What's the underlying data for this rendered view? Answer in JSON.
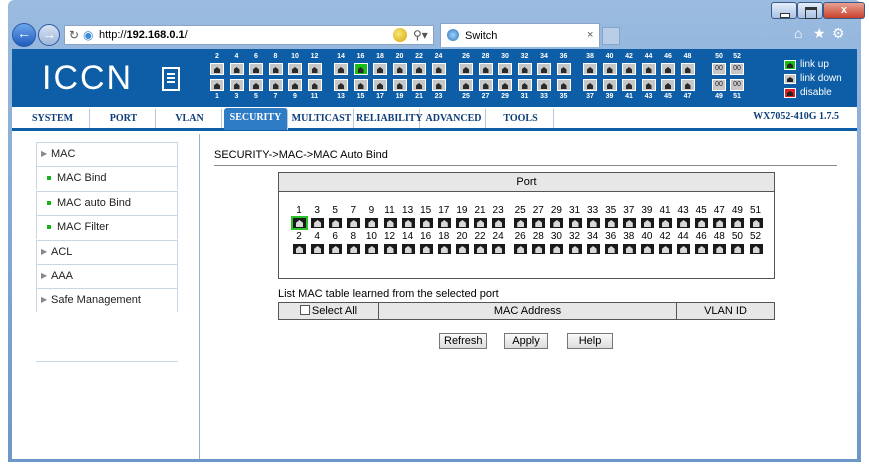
{
  "browser": {
    "url_prefix": "http://",
    "url_host": "192.168.0.1",
    "url_suffix": "/",
    "tab_title": "Switch",
    "tab_close": "×",
    "close_glyph": "x"
  },
  "banner": {
    "logo_text": "ICCN",
    "top_row_numbers": [
      "2",
      "4",
      "6",
      "8",
      "10",
      "12",
      "14",
      "16",
      "18",
      "20",
      "22",
      "24",
      "26",
      "28",
      "30",
      "32",
      "34",
      "36",
      "38",
      "40",
      "42",
      "44",
      "46",
      "48"
    ],
    "bottom_row_numbers": [
      "1",
      "3",
      "5",
      "7",
      "9",
      "11",
      "13",
      "15",
      "17",
      "19",
      "21",
      "23",
      "25",
      "27",
      "29",
      "31",
      "33",
      "35",
      "37",
      "39",
      "41",
      "43",
      "45",
      "47"
    ],
    "sfp_top_numbers": [
      "50",
      "52"
    ],
    "sfp_bottom_numbers": [
      "49",
      "51"
    ],
    "sfp_label": "00",
    "link_up_port": "16",
    "legend": {
      "link_up": "link up",
      "link_down": "link down",
      "disable": "disable"
    },
    "colors": {
      "link_up": "#19c019",
      "link_down": "#c7c7c7",
      "disable": "#e02020"
    }
  },
  "menu": {
    "items": [
      "SYSTEM",
      "PORT",
      "VLAN",
      "SECURITY",
      "MULTICAST",
      "RELIABILITY",
      "ADVANCED",
      "TOOLS"
    ],
    "active": "SECURITY",
    "version": "WX7052-410G 1.7.5"
  },
  "sidebar": {
    "items": [
      {
        "label": "MAC",
        "type": "top"
      },
      {
        "label": "MAC Bind",
        "type": "sub"
      },
      {
        "label": "MAC auto Bind",
        "type": "sub"
      },
      {
        "label": "MAC Filter",
        "type": "sub"
      },
      {
        "label": "ACL",
        "type": "top"
      },
      {
        "label": "AAA",
        "type": "top"
      },
      {
        "label": "Safe Management",
        "type": "top"
      }
    ]
  },
  "main": {
    "breadcrumb": "SECURITY->MAC->MAC Auto Bind",
    "port_header": "Port",
    "odd_ports": [
      "1",
      "3",
      "5",
      "7",
      "9",
      "11",
      "13",
      "15",
      "17",
      "19",
      "21",
      "23",
      "25",
      "27",
      "29",
      "31",
      "33",
      "35",
      "37",
      "39",
      "41",
      "43",
      "45",
      "47",
      "49",
      "51"
    ],
    "even_ports": [
      "2",
      "4",
      "6",
      "8",
      "10",
      "12",
      "14",
      "16",
      "18",
      "20",
      "22",
      "24",
      "26",
      "28",
      "30",
      "32",
      "34",
      "36",
      "38",
      "40",
      "42",
      "44",
      "46",
      "48",
      "50",
      "52"
    ],
    "selected_port": "1",
    "list_label": "List MAC table learned from the selected port",
    "table": {
      "select_all": "Select All",
      "mac_address": "MAC Address",
      "vlan_id": "VLAN ID"
    },
    "buttons": {
      "refresh": "Refresh",
      "apply": "Apply",
      "help": "Help"
    }
  }
}
